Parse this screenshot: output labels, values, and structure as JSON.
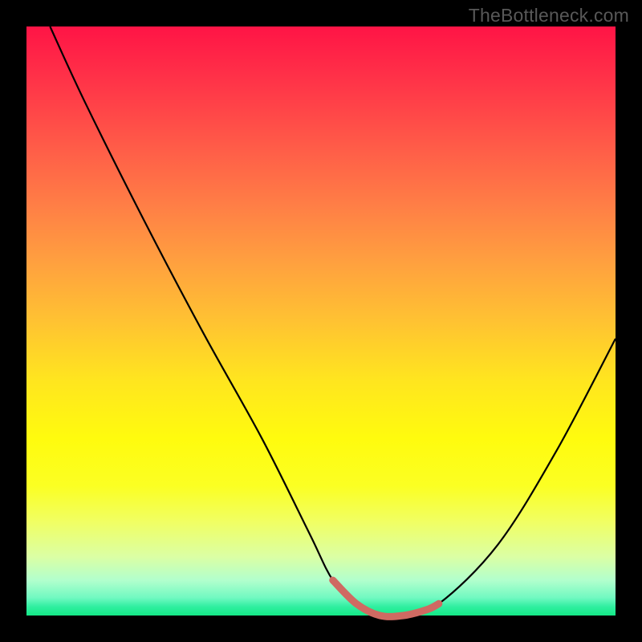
{
  "watermark": {
    "text": "TheBottleneck.com"
  },
  "colors": {
    "background": "#000000",
    "curve_stroke": "#000000",
    "marker_stroke": "#cf6a62",
    "marker_width": 9
  },
  "gradient_stops": [
    {
      "offset": 0.0,
      "color": "#ff1446"
    },
    {
      "offset": 0.1,
      "color": "#ff3648"
    },
    {
      "offset": 0.2,
      "color": "#ff5a48"
    },
    {
      "offset": 0.3,
      "color": "#ff7d46"
    },
    {
      "offset": 0.4,
      "color": "#ffa03f"
    },
    {
      "offset": 0.5,
      "color": "#ffc232"
    },
    {
      "offset": 0.6,
      "color": "#ffe51f"
    },
    {
      "offset": 0.7,
      "color": "#fffb0e"
    },
    {
      "offset": 0.78,
      "color": "#fbff23"
    },
    {
      "offset": 0.84,
      "color": "#f1ff62"
    },
    {
      "offset": 0.9,
      "color": "#dbffa4"
    },
    {
      "offset": 0.94,
      "color": "#b2ffcd"
    },
    {
      "offset": 0.97,
      "color": "#70f9c1"
    },
    {
      "offset": 0.985,
      "color": "#30efa0"
    },
    {
      "offset": 1.0,
      "color": "#14e987"
    }
  ],
  "chart_data": {
    "type": "line",
    "title": "",
    "xlabel": "",
    "ylabel": "",
    "xlim": [
      0,
      100
    ],
    "ylim": [
      0,
      100
    ],
    "grid": false,
    "legend": false,
    "series": [
      {
        "name": "bottleneck-curve",
        "x": [
          4,
          10,
          20,
          30,
          40,
          48,
          52,
          56,
          60,
          64,
          70,
          80,
          90,
          100
        ],
        "values": [
          100,
          87,
          67,
          48,
          30,
          14,
          6,
          2,
          0,
          0,
          2,
          12,
          28,
          47
        ]
      },
      {
        "name": "optimal-region-marker",
        "x": [
          52,
          56,
          60,
          64,
          68,
          70
        ],
        "values": [
          6,
          2,
          0,
          0,
          1,
          2
        ]
      }
    ]
  }
}
